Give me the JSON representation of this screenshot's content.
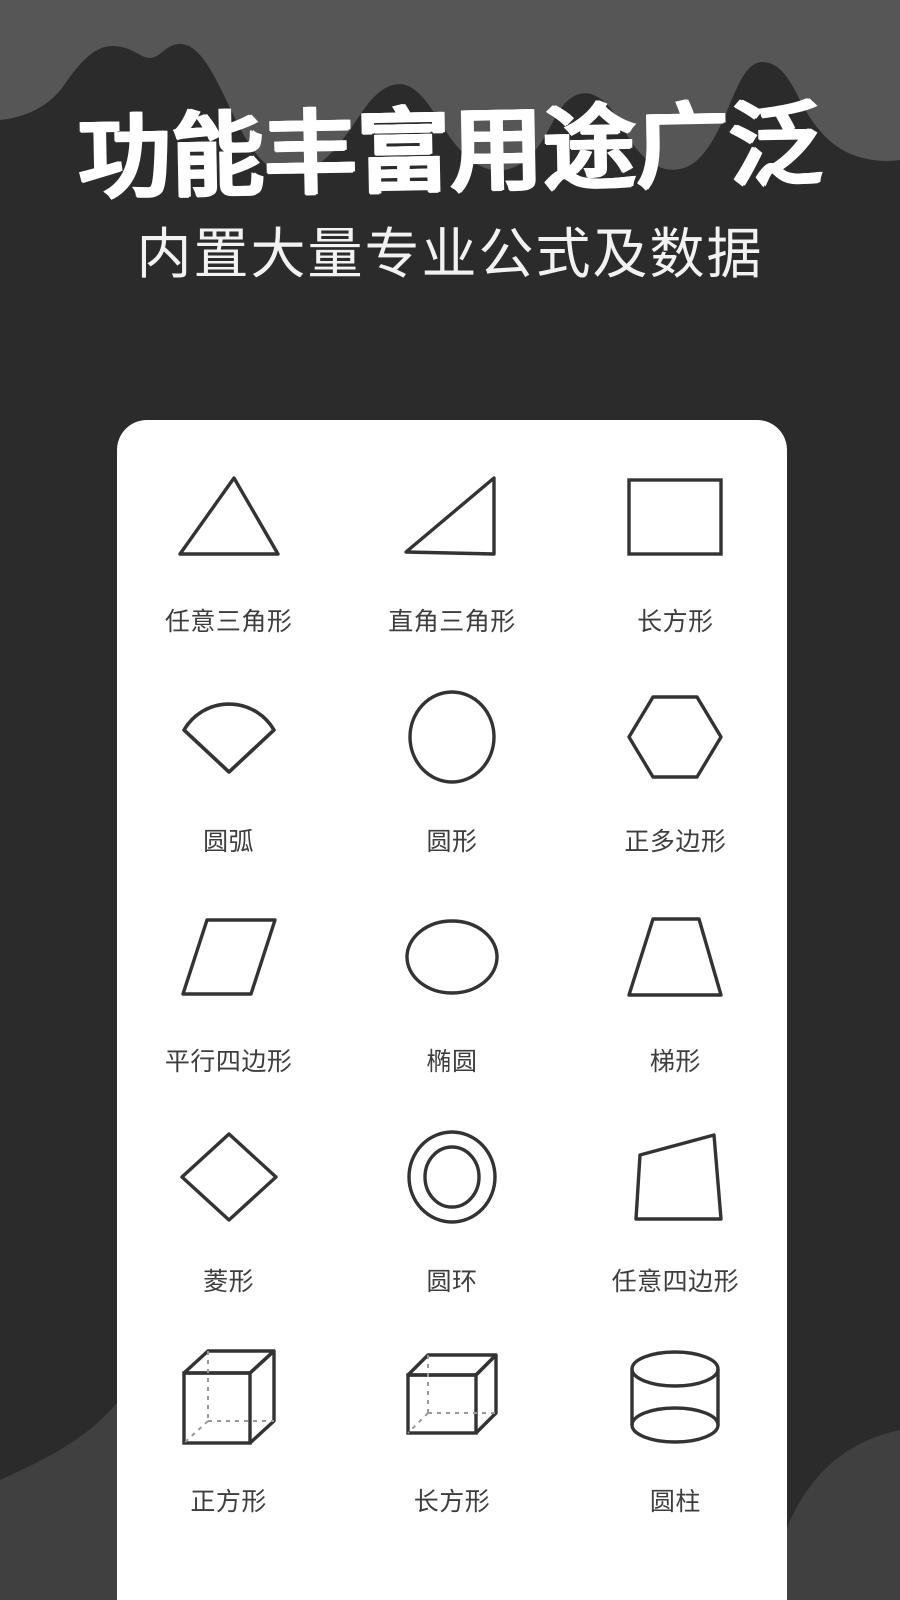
{
  "header": {
    "title": "功能丰富用途广泛",
    "subtitle": "内置大量专业公式及数据"
  },
  "colors": {
    "background_light": "#565656",
    "background_dark": "#2b2b2b",
    "card": "#ffffff",
    "title_text": "#ffffff",
    "subtitle_text": "#f2f2f2",
    "label_text": "#3d3d3d",
    "shape_stroke": "#333333"
  },
  "card": {
    "shapes": [
      {
        "label": "任意三角形",
        "icon": "arbitrary-triangle-shape"
      },
      {
        "label": "直角三角形",
        "icon": "right-triangle-shape"
      },
      {
        "label": "长方形",
        "icon": "rectangle-shape"
      },
      {
        "label": "圆弧",
        "icon": "arc-sector-shape"
      },
      {
        "label": "圆形",
        "icon": "circle-shape"
      },
      {
        "label": "正多边形",
        "icon": "regular-polygon-shape"
      },
      {
        "label": "平行四边形",
        "icon": "parallelogram-shape"
      },
      {
        "label": "椭圆",
        "icon": "ellipse-shape"
      },
      {
        "label": "梯形",
        "icon": "trapezoid-shape"
      },
      {
        "label": "菱形",
        "icon": "rhombus-shape"
      },
      {
        "label": "圆环",
        "icon": "annulus-ring-shape"
      },
      {
        "label": "任意四边形",
        "icon": "arbitrary-quadrilateral-shape"
      },
      {
        "label": "正方形",
        "icon": "cube-shape"
      },
      {
        "label": "长方形",
        "icon": "cuboid-shape"
      },
      {
        "label": "圆柱",
        "icon": "cylinder-shape"
      }
    ]
  }
}
